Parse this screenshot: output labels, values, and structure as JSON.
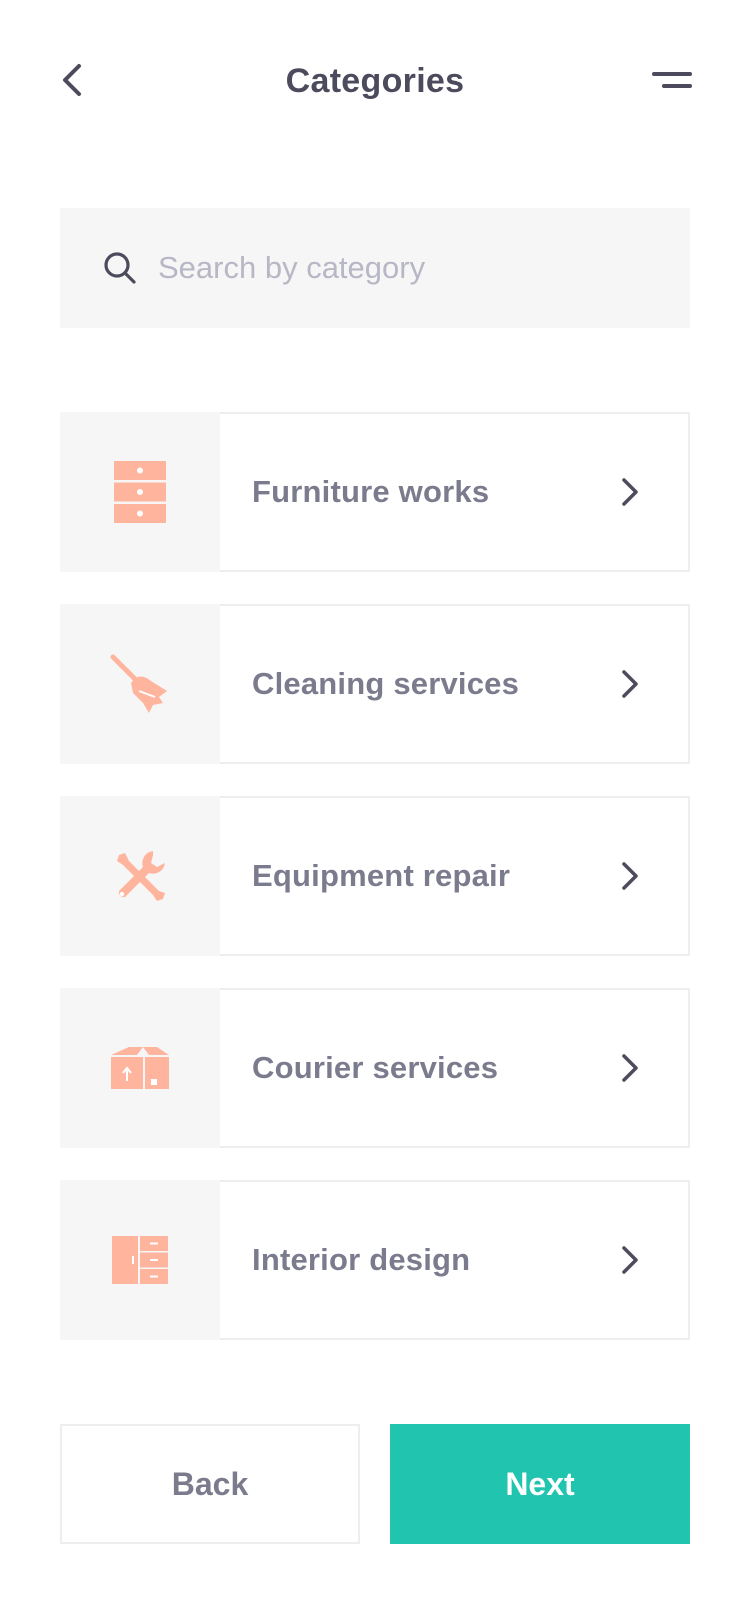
{
  "header": {
    "title": "Categories"
  },
  "search": {
    "placeholder": "Search by category",
    "value": ""
  },
  "categories": [
    {
      "label": "Furniture works",
      "icon": "drawer-cabinet-icon"
    },
    {
      "label": "Cleaning services",
      "icon": "broom-icon"
    },
    {
      "label": "Equipment repair",
      "icon": "wrench-screwdriver-icon"
    },
    {
      "label": "Courier services",
      "icon": "package-box-icon"
    },
    {
      "label": "Interior design",
      "icon": "wardrobe-icon"
    }
  ],
  "footer": {
    "back_label": "Back",
    "next_label": "Next"
  },
  "colors": {
    "accent": "#21c4af",
    "icon": "#ffb59d",
    "title": "#4b4b5d",
    "label": "#7b7b8e",
    "placeholder": "#b7b7c6",
    "panel": "#f6f6f6"
  }
}
